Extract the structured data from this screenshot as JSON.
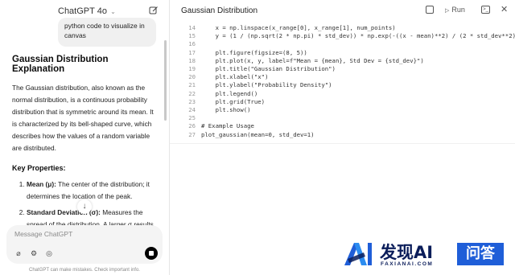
{
  "chat": {
    "model_label": "ChatGPT 4o",
    "user_message": "python code to visualize in canvas",
    "heading": "Gaussian Distribution Explanation",
    "paragraph": "The Gaussian distribution, also known as the normal distribution, is a continuous probability distribution that is symmetric around its mean. It is characterized by its bell-shaped curve, which describes how the values of a random variable are distributed.",
    "key_properties_heading": "Key Properties:",
    "properties": [
      {
        "term": "Mean (μ):",
        "text": " The center of the distribution; it determines the location of the peak."
      },
      {
        "term": "Standard Deviation (σ):",
        "text": " Measures the spread of the distribution. A larger σ results in a wider curve, while a smaller σ"
      }
    ],
    "composer_placeholder": "Message ChatGPT",
    "disclaimer": "ChatGPT can make mistakes. Check important info."
  },
  "canvas": {
    "title": "Gaussian Distribution",
    "run_label": "Run",
    "code_lines": [
      {
        "num": "14",
        "text": "    x = np.linspace(x_range[0], x_range[1], num_points)"
      },
      {
        "num": "15",
        "text": "    y = (1 / (np.sqrt(2 * np.pi) * std_dev)) * np.exp(-((x - mean)**2) / (2 * std_dev**2))"
      },
      {
        "num": "16",
        "text": ""
      },
      {
        "num": "17",
        "text": "    plt.figure(figsize=(8, 5))"
      },
      {
        "num": "18",
        "text": "    plt.plot(x, y, label=f\"Mean = {mean}, Std Dev = {std_dev}\")"
      },
      {
        "num": "19",
        "text": "    plt.title(\"Gaussian Distribution\")"
      },
      {
        "num": "20",
        "text": "    plt.xlabel(\"x\")"
      },
      {
        "num": "21",
        "text": "    plt.ylabel(\"Probability Density\")"
      },
      {
        "num": "22",
        "text": "    plt.legend()"
      },
      {
        "num": "23",
        "text": "    plt.grid(True)"
      },
      {
        "num": "24",
        "text": "    plt.show()"
      },
      {
        "num": "25",
        "text": ""
      },
      {
        "num": "26",
        "text": "# Example Usage"
      },
      {
        "num": "27",
        "text": "plot_gaussian(mean=0, std_dev=1)"
      }
    ]
  },
  "watermark": {
    "main": "发现AI",
    "sub": "FAXIANAI.COM",
    "badge": "问答",
    "colors": {
      "navy": "#0b1d5a",
      "blue": "#1f5ed8"
    }
  }
}
